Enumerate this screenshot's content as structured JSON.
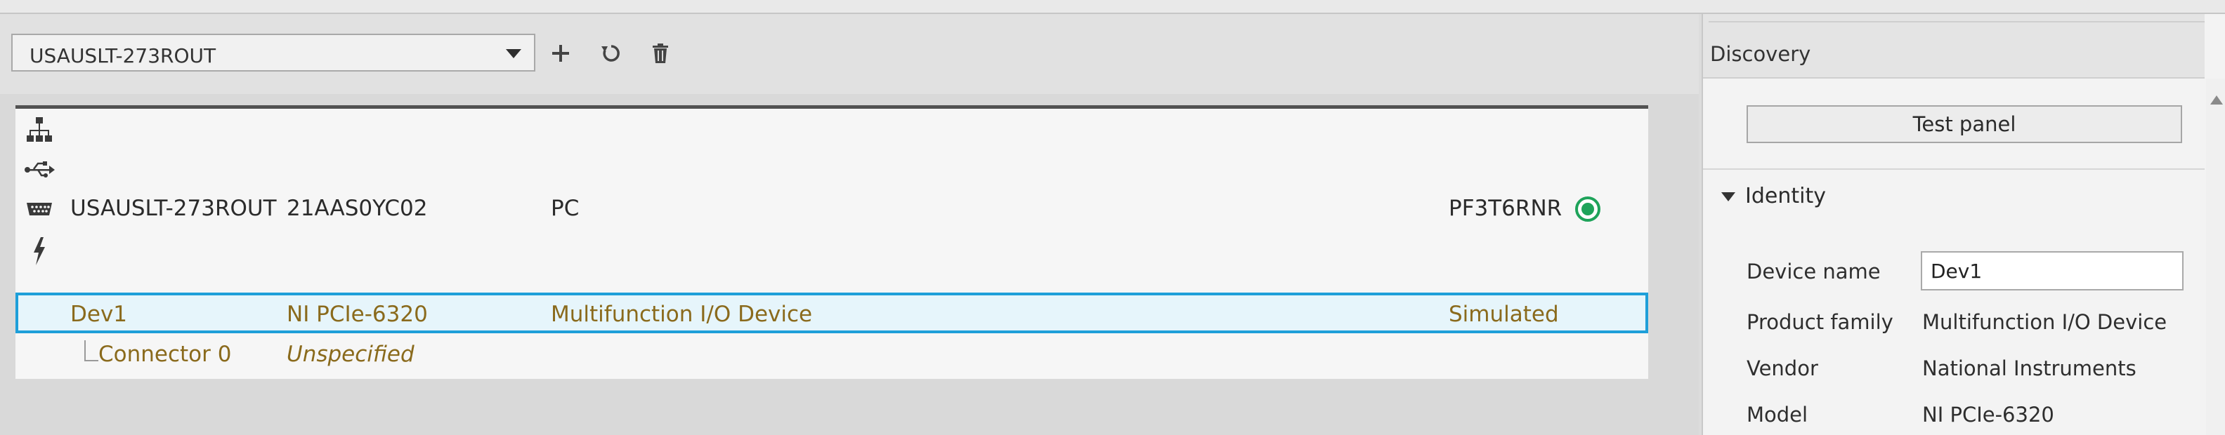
{
  "toolbar": {
    "system_selector_value": "USAUSLT-273ROUT",
    "add_icon": "plus-icon",
    "refresh_icon": "refresh-icon",
    "delete_icon": "trash-icon"
  },
  "system_row": {
    "name": "USAUSLT-273ROUT",
    "serial": "21AAS0YC02",
    "type": "PC",
    "status": "PF3T6RNR",
    "status_color": "#1ea35a",
    "side_icons": [
      "network-icon",
      "usb-icon",
      "serial-port-icon",
      "power-icon"
    ]
  },
  "device_row": {
    "name": "Dev1",
    "model": "NI PCIe-6320",
    "family": "Multifunction I/O Device",
    "status": "Simulated"
  },
  "connector_row": {
    "name": "Connector 0",
    "value": "Unspecified"
  },
  "colors": {
    "selection_border": "#1e9fd9",
    "selection_fill": "#e6f5fb",
    "device_text": "#8a6a1c"
  },
  "right_panel": {
    "tab_label": "Discovery",
    "test_panel_button": "Test panel",
    "section_identity": "Identity",
    "properties": {
      "device_name_label": "Device name",
      "device_name_value": "Dev1",
      "product_family_label": "Product family",
      "product_family_value": "Multifunction I/O Device",
      "vendor_label": "Vendor",
      "vendor_value": "National Instruments",
      "model_label": "Model",
      "model_value": "NI PCIe-6320"
    }
  }
}
